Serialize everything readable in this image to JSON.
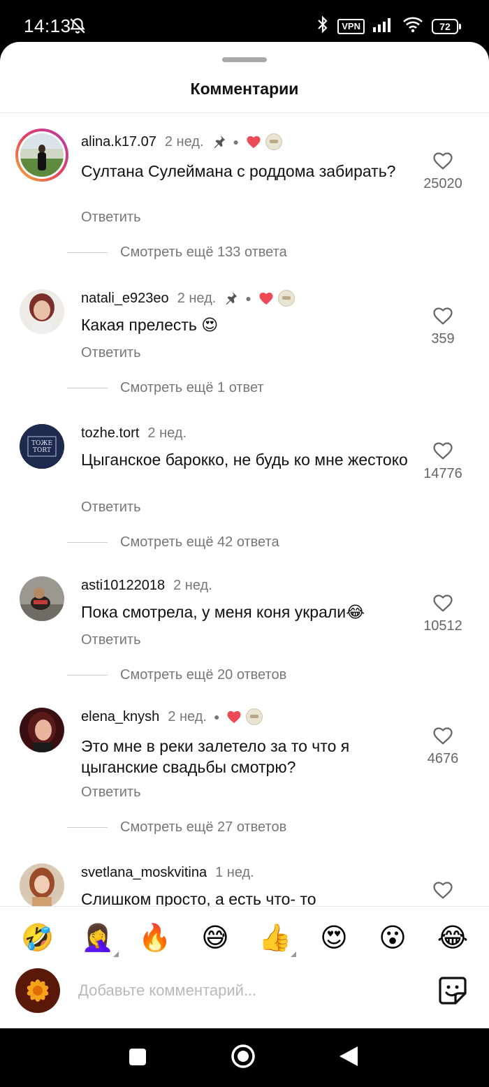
{
  "status_bar": {
    "time": "14:13",
    "vpn": "VPN",
    "battery": "72"
  },
  "sheet": {
    "title": "Комментарии"
  },
  "comments": [
    {
      "username": "alina.k17.07",
      "ago": "2 нед.",
      "pinned": true,
      "liked_by_author": true,
      "text": "Султана Сулеймана с роддома забирать?",
      "reply": "Ответить",
      "likes": "25020",
      "more_replies": "Смотреть ещё 133 ответа"
    },
    {
      "username": "natali_e923eo",
      "ago": "2 нед.",
      "pinned": true,
      "liked_by_author": true,
      "text": "Какая прелесть 😍",
      "reply": "Ответить",
      "likes": "359",
      "more_replies": "Смотреть ещё 1 ответ"
    },
    {
      "username": "tozhe.tort",
      "ago": "2 нед.",
      "pinned": false,
      "liked_by_author": false,
      "text": "Цыганское барокко, не будь ко мне жестоко",
      "reply": "Ответить",
      "likes": "14776",
      "more_replies": "Смотреть ещё 42 ответа",
      "avatar_text": "ТОЖЕ TORT"
    },
    {
      "username": "asti10122018",
      "ago": "2 нед.",
      "pinned": false,
      "liked_by_author": false,
      "text": "Пока смотрела, у меня коня украли😂",
      "reply": "Ответить",
      "likes": "10512",
      "more_replies": "Смотреть ещё 20 ответов"
    },
    {
      "username": "elena_knysh",
      "ago": "2 нед.",
      "pinned": false,
      "liked_by_author": true,
      "text": "Это мне в реки залетело за то что я цыганские свадьбы смотрю?",
      "reply": "Ответить",
      "likes": "4676",
      "more_replies": "Смотреть ещё 27 ответов"
    },
    {
      "username": "svetlana_moskvitina",
      "ago": "1 нед.",
      "pinned": false,
      "liked_by_author": false,
      "text": "Слишком просто, а есть что- то",
      "reply": "",
      "likes": "",
      "more_replies": ""
    }
  ],
  "emoji_bar": [
    "🤣",
    "🤦‍♀️",
    "🔥",
    "😅",
    "👍",
    "😍",
    "😮",
    "😂"
  ],
  "composer": {
    "placeholder": "Добавьте комментарий..."
  },
  "colors": {
    "heart_red": "#ed4956",
    "muted_text": "#777777",
    "story_ring_start": "#f9b12f",
    "story_ring_end": "#b23ab4"
  },
  "icons": [
    "bell-off-icon",
    "bluetooth-icon",
    "signal-icon",
    "wifi-icon",
    "battery-icon",
    "pin-icon",
    "heart-icon",
    "sticker-icon",
    "square-nav-icon",
    "circle-nav-icon",
    "back-triangle-icon"
  ]
}
